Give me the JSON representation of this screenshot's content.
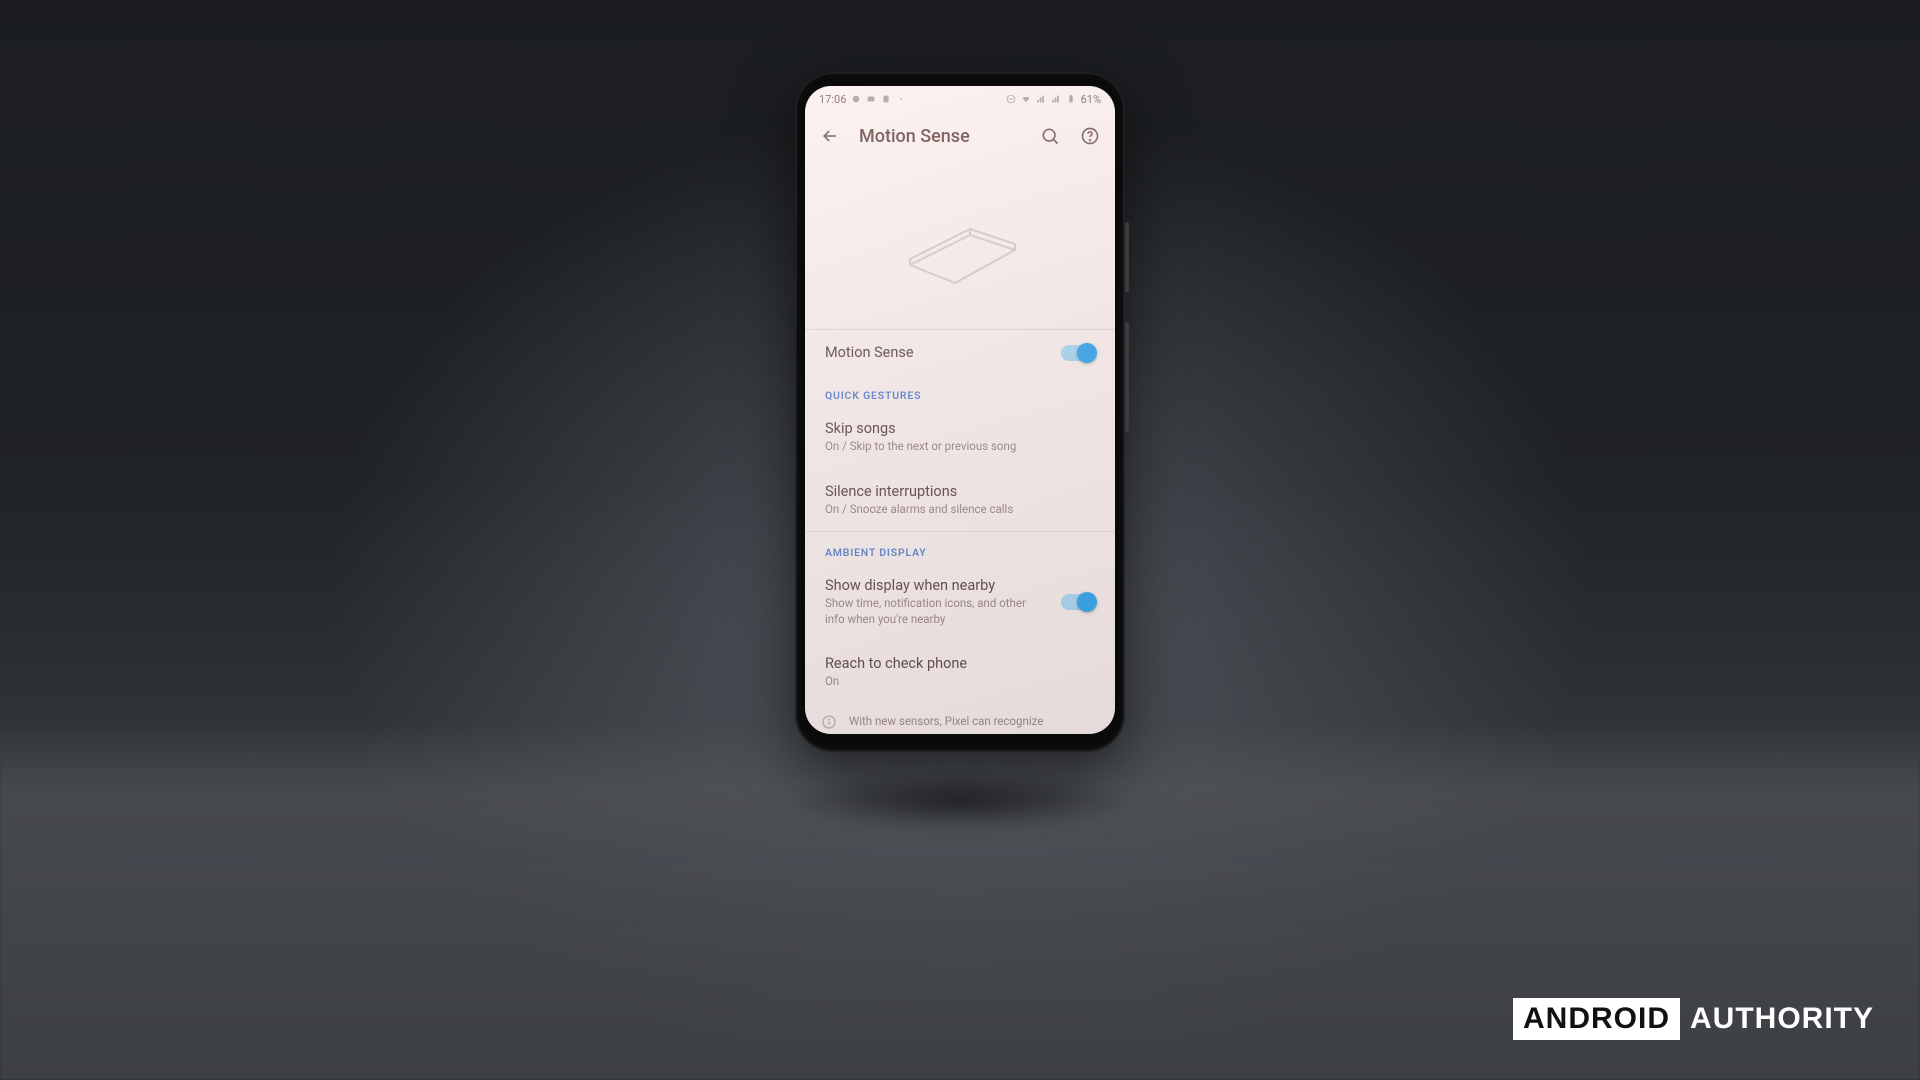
{
  "watermark": {
    "boxed": "ANDROID",
    "plain": "AUTHORITY"
  },
  "status_bar": {
    "time": "17:06",
    "battery": "61%"
  },
  "app_bar": {
    "title": "Motion Sense"
  },
  "main_toggle": {
    "label": "Motion Sense",
    "on": true
  },
  "sections": {
    "quick_gestures": {
      "label": "QUICK GESTURES",
      "items": [
        {
          "title": "Skip songs",
          "subtitle": "On / Skip to the next or previous song"
        },
        {
          "title": "Silence interruptions",
          "subtitle": "On / Snooze alarms and silence calls"
        }
      ]
    },
    "ambient_display": {
      "label": "AMBIENT DISPLAY",
      "items": [
        {
          "title": "Show display when nearby",
          "subtitle": "Show time, notification icons, and other info when you're nearby",
          "toggle": true
        },
        {
          "title": "Reach to check phone",
          "subtitle": "On"
        }
      ]
    }
  },
  "footer_info": "With new sensors, Pixel can recognize"
}
